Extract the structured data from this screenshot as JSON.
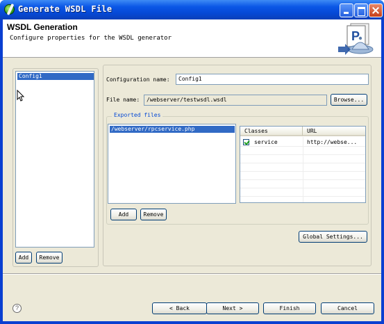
{
  "window": {
    "title": "Generate WSDL File",
    "colors": {
      "titlebar": "#0a56e6",
      "selection": "#316ac5",
      "legend": "#0046d5"
    }
  },
  "banner": {
    "title": "WSDL Generation",
    "subtitle": "Configure properties for the WSDL generator",
    "icon": "wsdl-wizard-icon"
  },
  "configs": {
    "items": [
      "Config1"
    ],
    "selected_index": 0,
    "add_label": "Add",
    "remove_label": "Remove"
  },
  "form": {
    "config_name_label": "Configuration name:",
    "config_name_value": "Config1",
    "file_name_label": "File name:",
    "file_name_value": "/webserver/testwsdl.wsdl",
    "browse_label": "Browse..."
  },
  "exported": {
    "legend": "Exported files",
    "files": [
      "/webserver/rpcservice.php"
    ],
    "add_label": "Add",
    "remove_label": "Remove",
    "table": {
      "headers": [
        "Classes",
        "URL"
      ],
      "rows": [
        {
          "checked": true,
          "class": "service",
          "url": "http://webse..."
        }
      ]
    }
  },
  "global_settings_label": "Global Settings...",
  "footer": {
    "back_label": "< Back",
    "next_label": "Next >",
    "finish_label": "Finish",
    "cancel_label": "Cancel"
  }
}
